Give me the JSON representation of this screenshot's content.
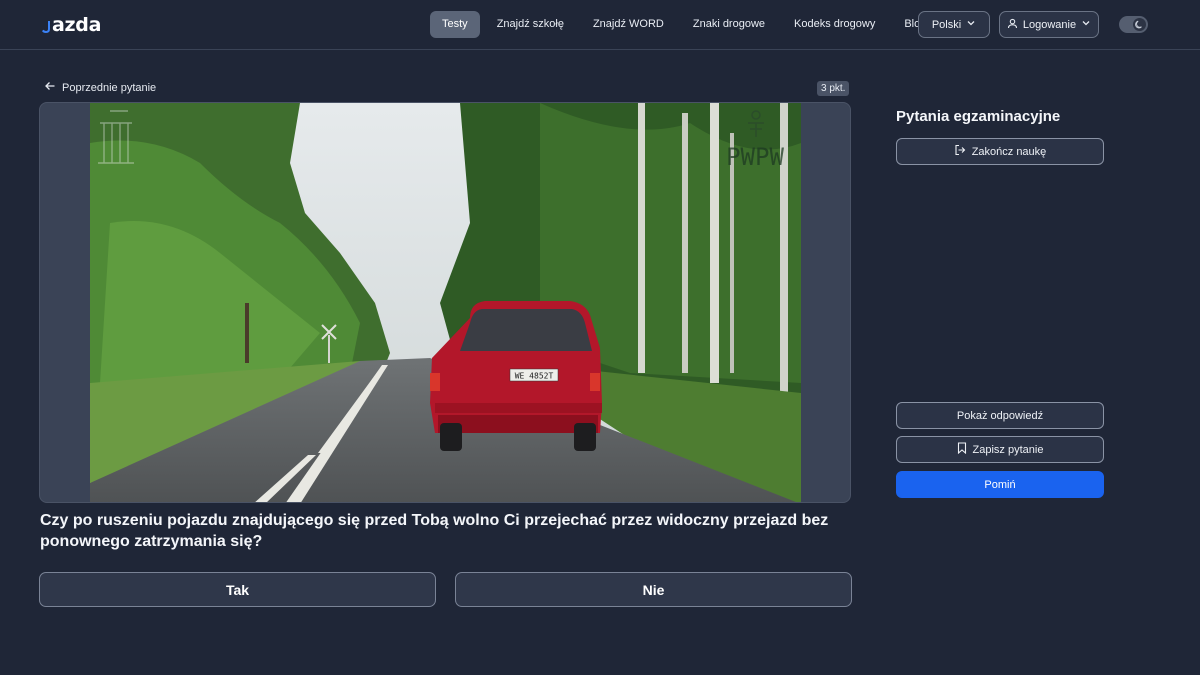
{
  "header": {
    "logo_text": "azda",
    "nav": [
      {
        "label": "Testy",
        "active": true
      },
      {
        "label": "Znajdź szkołę",
        "active": false
      },
      {
        "label": "Znajdź WORD",
        "active": false
      },
      {
        "label": "Znaki drogowe",
        "active": false
      },
      {
        "label": "Kodeks drogowy",
        "active": false
      },
      {
        "label": "Blog",
        "active": false
      }
    ],
    "language": "Polski",
    "login": "Logowanie"
  },
  "question": {
    "back_label": "Poprzednie pytanie",
    "points": "3 pkt.",
    "media_watermark": "PWPW",
    "plate": "WE 4852T",
    "text": "Czy po ruszeniu pojazdu znajdującego się przed Tobą wolno Ci przejechać przez widoczny przejazd bez ponownego zatrzymania się?",
    "answers": {
      "yes": "Tak",
      "no": "Nie"
    }
  },
  "sidebar": {
    "title": "Pytania egzaminacyjne",
    "end_label": "Zakończ naukę",
    "show_answer_label": "Pokaż odpowiedź",
    "save_label": "Zapisz pytanie",
    "skip_label": "Pomiń"
  },
  "colors": {
    "background": "#1f2637",
    "accent": "#1a63ef",
    "nav_active": "#5b6578"
  }
}
